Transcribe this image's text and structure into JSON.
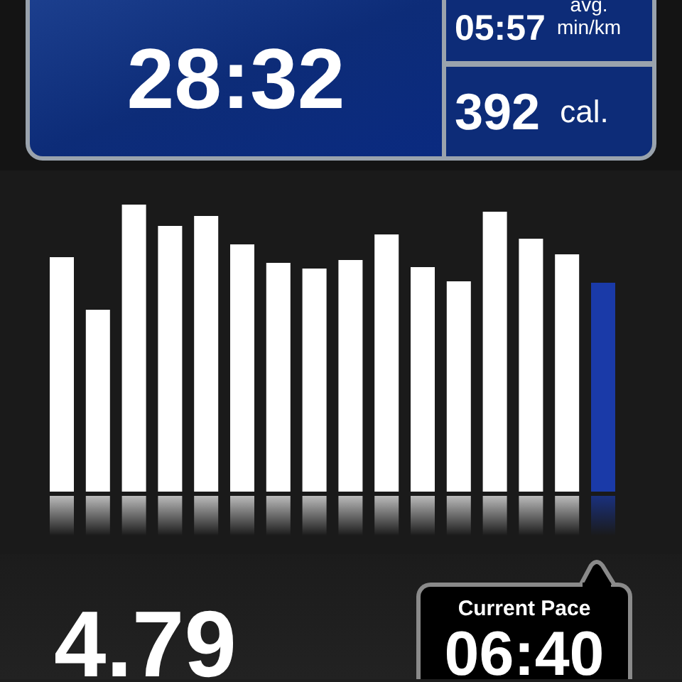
{
  "summary_panel": {
    "duration": "28:32",
    "avg_pace": {
      "value": "05:57",
      "unit_line_1": "avg.",
      "unit_line_2": "min/km"
    },
    "calories": {
      "value": "392",
      "unit": "cal."
    }
  },
  "distance": "4.79",
  "current_pace": {
    "label": "Current Pace",
    "value": "06:40"
  }
}
